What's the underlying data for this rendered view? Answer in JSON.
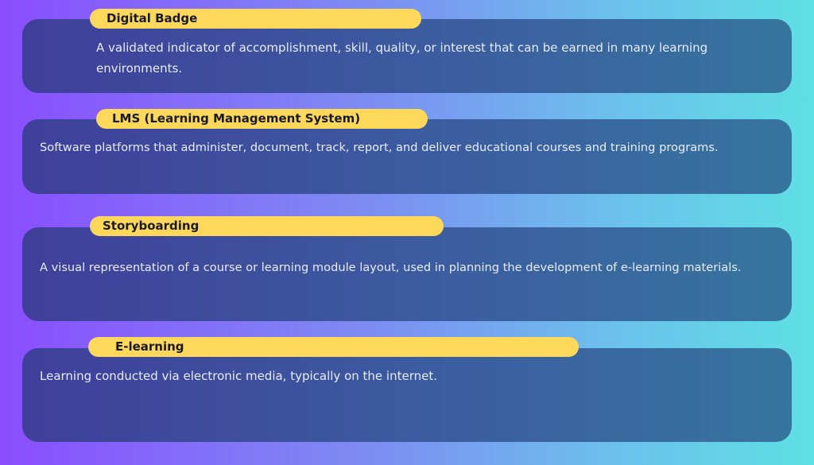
{
  "terms": [
    {
      "title": "Digital Badge",
      "description": "A validated indicator of accomplishment, skill, quality, or interest that can be earned in many learning environments."
    },
    {
      "title": "LMS (Learning Management System)",
      "description": "Software platforms that administer, document, track, report, and deliver educational courses and training programs."
    },
    {
      "title": "Storyboarding",
      "description": "A visual representation of a course or learning module layout, used in planning the development of e-learning materials."
    },
    {
      "title": "E-learning",
      "description": "Learning conducted via electronic media, typically on the internet."
    }
  ],
  "colors": {
    "pill": "#fdd85a",
    "card": "#3c5da0",
    "text": "#e8ecf8"
  }
}
